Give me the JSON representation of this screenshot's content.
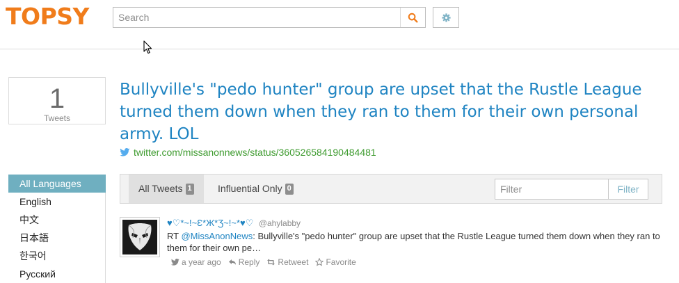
{
  "header": {
    "logo": "TOPSY",
    "search": {
      "placeholder": "Search",
      "value": ""
    },
    "icons": {
      "search": "search-icon",
      "settings": "gear-icon",
      "pointer": "mouse-pointer-icon"
    },
    "colors": {
      "brand": "#f07c1b",
      "search_icon": "#f07c1b",
      "settings_icon": "#7fb3c6"
    }
  },
  "count": {
    "value": "1",
    "label": "Tweets"
  },
  "headline": {
    "text": "Bullyville's \"pedo hunter\" group are upset that the Rustle League turned them down when they ran to them for their own personal army. LOL",
    "source": "twitter.com/missanonnews/status/360526584190484481",
    "source_icon": "twitter-bird-icon",
    "color": "#1f84c2",
    "source_color": "#3e9b2f"
  },
  "languages": {
    "items": [
      {
        "label": "All Languages",
        "active": true
      },
      {
        "label": "English",
        "active": false
      },
      {
        "label": "中文",
        "active": false
      },
      {
        "label": "日本語",
        "active": false
      },
      {
        "label": "한국어",
        "active": false
      },
      {
        "label": "Русский",
        "active": false
      }
    ],
    "active_color": "#6fafc0"
  },
  "tabs": {
    "items": [
      {
        "label": "All Tweets",
        "count": "1",
        "active": true
      },
      {
        "label": "Influential Only",
        "count": "0",
        "active": false
      }
    ],
    "filter": {
      "placeholder": "Filter",
      "button": "Filter"
    }
  },
  "tweet": {
    "author": "♥♡*~!~Ɛ*Ж*Ʒ~!~*♥♡",
    "handle": "@ahylabby",
    "text_prefix": "RT ",
    "mention": "@MissAnonNews",
    "text_rest": ": Bullyville's \"pedo hunter\" group are upset that the Rustle League turned them down when they ran to them for their own pe…",
    "avatar_icon": "mask-avatar-icon",
    "actions": {
      "time": "a year ago",
      "reply": "Reply",
      "retweet": "Retweet",
      "favorite": "Favorite"
    }
  }
}
